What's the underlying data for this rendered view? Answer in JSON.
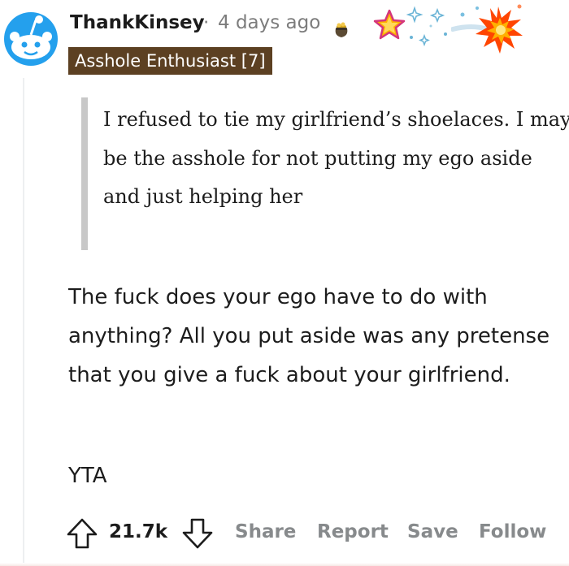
{
  "comment": {
    "username": "ThankKinsey",
    "separator": "·",
    "timestamp": "4 days ago",
    "flair": "Asshole Enthusiast [7]",
    "awards": [
      "gold-pot-award-icon",
      "star-award-icon",
      "sparkles-award-icon",
      "explosion-award-icon"
    ],
    "quote": "I refused to tie my girlfriend’s shoelaces. I may be the asshole for not putting my ego aside and just helping her",
    "body": "The fuck does your ego have to do with anything? All you put aside was any pretense that you give a fuck about your girlfriend.",
    "verdict": "YTA"
  },
  "actions": {
    "score": "21.7k",
    "share_label": "Share",
    "report_label": "Report",
    "save_label": "Save",
    "follow_label": "Follow"
  },
  "colors": {
    "flair_background": "#5c4022",
    "avatar_background": "#24a0ed",
    "muted_text": "#7c7c7c",
    "action_text": "#878a8c"
  }
}
